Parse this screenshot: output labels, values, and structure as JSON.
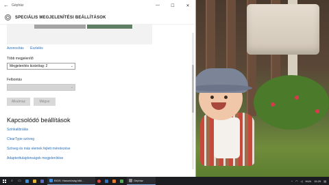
{
  "window": {
    "title": "Gépház",
    "controls": {
      "minimize": "—",
      "maximize": "☐",
      "close": "✕"
    }
  },
  "header": {
    "title": "SPECIÁLIS MEGJELENÍTÉSI BEÁLLÍTÁSOK"
  },
  "links": {
    "identify": "Azonosítás",
    "detect": "Észlelés"
  },
  "multiple_displays": {
    "label": "Több megjelenítő",
    "value": "Megjelenítés kizárólag: 2"
  },
  "resolution": {
    "label": "Felbontás",
    "value": ""
  },
  "buttons": {
    "apply": "Alkalmaz",
    "cancel": "Mégse"
  },
  "related": {
    "title": "Kapcsolódó beállítások",
    "items": [
      "Színkalibrálás",
      "ClearType szöveg",
      "Szöveg és más elemek fejlett méretezése",
      "Adapterttulajdonságok megjelenítése"
    ]
  },
  "taskbar": {
    "tasks": [
      {
        "label": "BIOS: Hasonlóság kitö..."
      },
      {
        "label": "Gépház"
      }
    ],
    "tray": {
      "language": "HUN",
      "time": "15:29"
    }
  },
  "colors": {
    "accent": "#2b6fb8",
    "monitor_active": "#5f7e63",
    "monitor_inactive": "#a3a3a3"
  }
}
